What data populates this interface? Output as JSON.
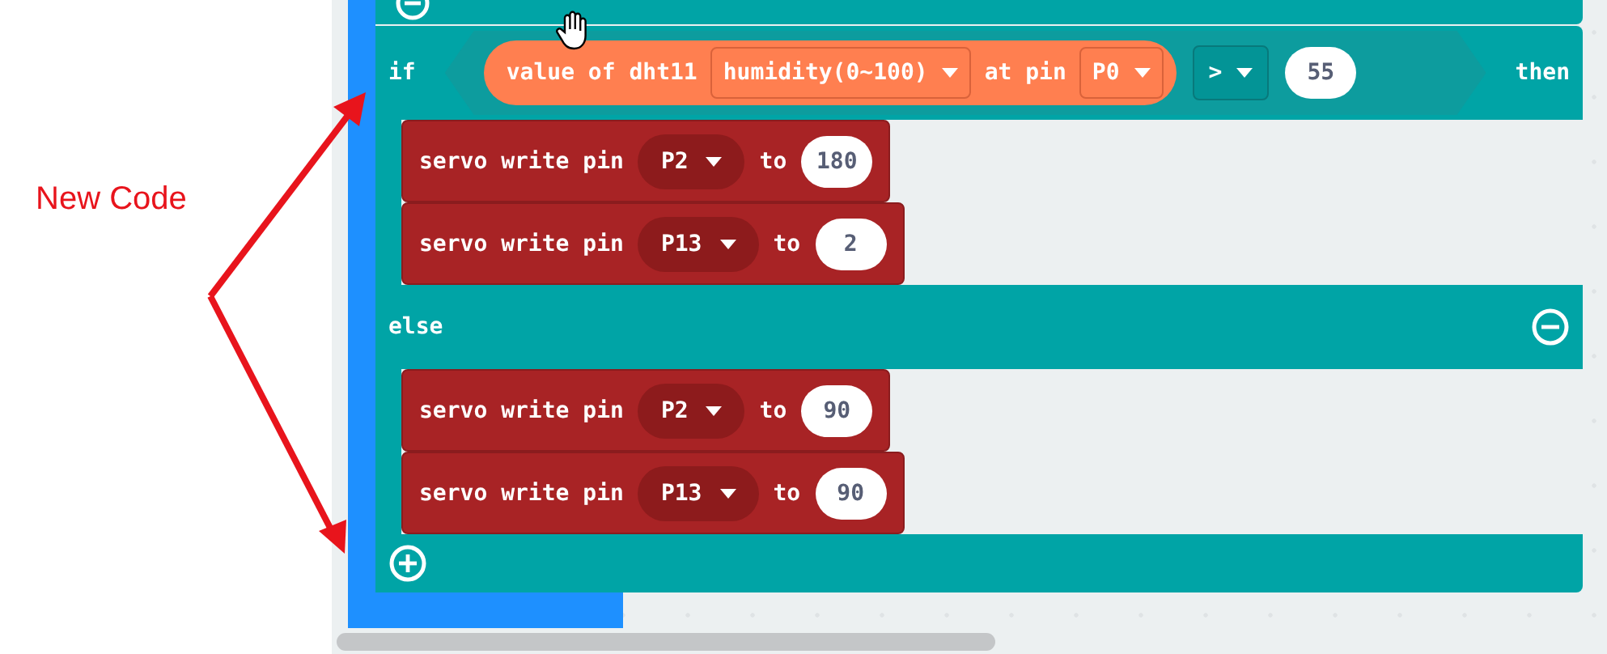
{
  "annotation": {
    "label": "New Code"
  },
  "if_block": {
    "keyword": "if",
    "condition": {
      "sensor": "value of dht11",
      "reading": "humidity(0~100)",
      "pin_label": "at pin",
      "pin": "P0",
      "operator": ">",
      "threshold": "55"
    },
    "then": "then",
    "then_statements": [
      {
        "text": "servo write pin",
        "pin": "P2",
        "to": "to",
        "value": "180"
      },
      {
        "text": "servo write pin",
        "pin": "P13",
        "to": "to",
        "value": "2"
      }
    ],
    "else": "else",
    "else_statements": [
      {
        "text": "servo write pin",
        "pin": "P2",
        "to": "to",
        "value": "90"
      },
      {
        "text": "servo write pin",
        "pin": "P13",
        "to": "to",
        "value": "90"
      }
    ]
  }
}
